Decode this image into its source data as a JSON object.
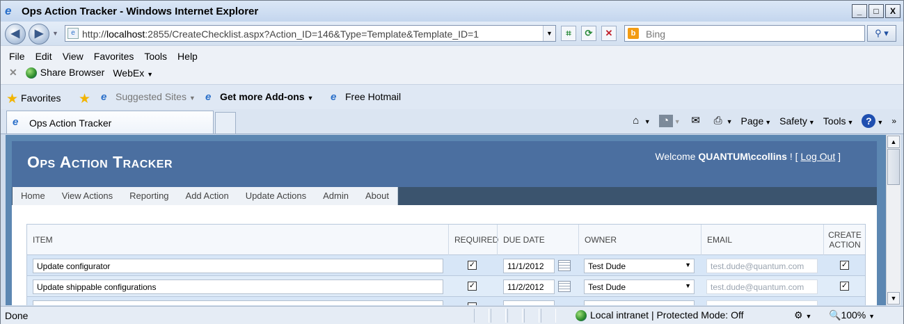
{
  "window": {
    "title": "Ops Action Tracker - Windows Internet Explorer",
    "buttons": [
      "_",
      "□",
      "X"
    ]
  },
  "address": {
    "url_prefix": "http://",
    "url_host": "localhost",
    "url_rest": ":2855/CreateChecklist.aspx?Action_ID=146&Type=Template&Template_ID=1",
    "search_placeholder": "Bing"
  },
  "menubar": {
    "items": [
      "File",
      "Edit",
      "View",
      "Favorites",
      "Tools",
      "Help"
    ],
    "share": "Share Browser",
    "webex": "WebEx"
  },
  "favorites": {
    "label": "Favorites",
    "suggested": "Suggested Sites",
    "addons": "Get more Add-ons",
    "hotmail": "Free Hotmail"
  },
  "tab": {
    "label": "Ops Action Tracker"
  },
  "commandbar": {
    "page": "Page",
    "safety": "Safety",
    "tools": "Tools"
  },
  "app": {
    "title": "Ops Action Tracker",
    "welcome_prefix": "Welcome ",
    "user": "QUANTUM\\ccollins",
    "welcome_mid": " ! [ ",
    "logout": "Log Out",
    "welcome_end": " ]",
    "nav": [
      "Home",
      "View Actions",
      "Reporting",
      "Add Action",
      "Update Actions",
      "Admin",
      "About"
    ]
  },
  "grid": {
    "headers": {
      "item": "ITEM",
      "required": "REQUIRED",
      "due": "DUE DATE",
      "owner": "OWNER",
      "email": "EMAIL",
      "create": "CREATE ACTION"
    },
    "rows": [
      {
        "item": "Update configurator",
        "required": true,
        "due": "11/1/2012",
        "owner": "Test Dude",
        "email": "test.dude@quantum.com",
        "create": true
      },
      {
        "item": "Update shippable configurations",
        "required": true,
        "due": "11/2/2012",
        "owner": "Test Dude",
        "email": "test.dude@quantum.com",
        "create": true
      }
    ]
  },
  "status": {
    "left": "Done",
    "zone": "Local intranet | Protected Mode: Off",
    "zoom": "100%"
  }
}
